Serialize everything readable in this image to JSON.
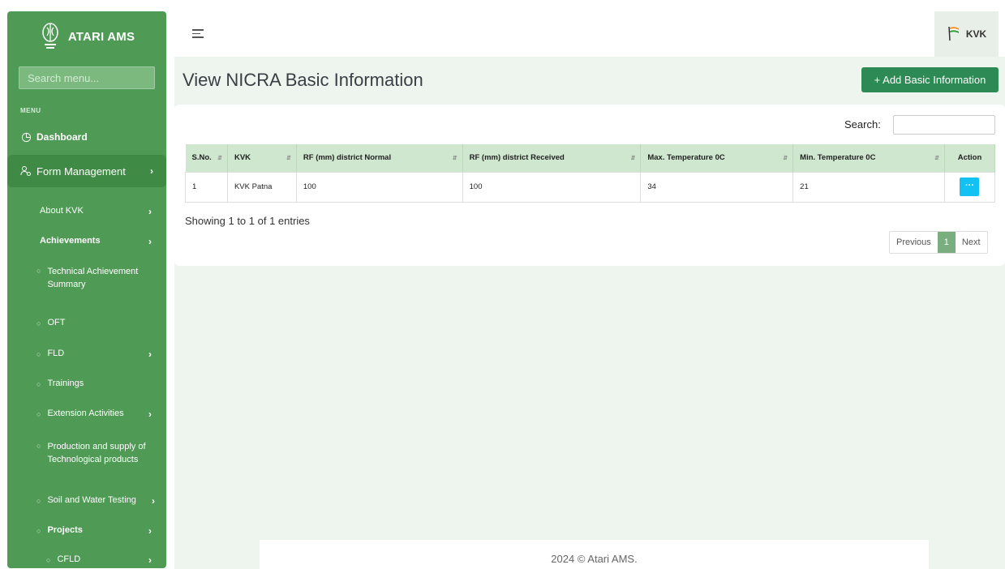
{
  "brand": {
    "title": "ATARI AMS"
  },
  "sidebar": {
    "search_placeholder": "Search menu...",
    "menu_label": "MENU",
    "dashboard": "Dashboard",
    "form_management": "Form Management",
    "items": [
      {
        "label": "About KVK"
      },
      {
        "label": "Achievements"
      },
      {
        "label": "Technical Achievement Summary"
      },
      {
        "label": "OFT"
      },
      {
        "label": "FLD"
      },
      {
        "label": "Trainings"
      },
      {
        "label": "Extension Activities"
      },
      {
        "label": "Production and supply of Technological products"
      },
      {
        "label": "Soil and Water Testing"
      },
      {
        "label": "Projects"
      },
      {
        "label": "CFLD"
      }
    ]
  },
  "topbar": {
    "user": "KVK"
  },
  "page": {
    "title": "View NICRA Basic Information",
    "add_button": "+ Add Basic Information",
    "search_label": "Search:"
  },
  "table": {
    "headers": [
      "S.No.",
      "KVK",
      "RF (mm) district Normal",
      "RF (mm) district Received",
      "Max. Temperature 0C",
      "Min. Temperature 0C",
      "Action"
    ],
    "rows": [
      {
        "sno": "1",
        "kvk": "KVK Patna",
        "rf_normal": "100",
        "rf_received": "100",
        "max_temp": "34",
        "min_temp": "21",
        "action": "···"
      }
    ]
  },
  "pagination": {
    "info": "Showing 1 to 1 of 1 entries",
    "previous": "Previous",
    "current": "1",
    "next": "Next"
  },
  "footer": {
    "text": "2024 © Atari AMS."
  }
}
